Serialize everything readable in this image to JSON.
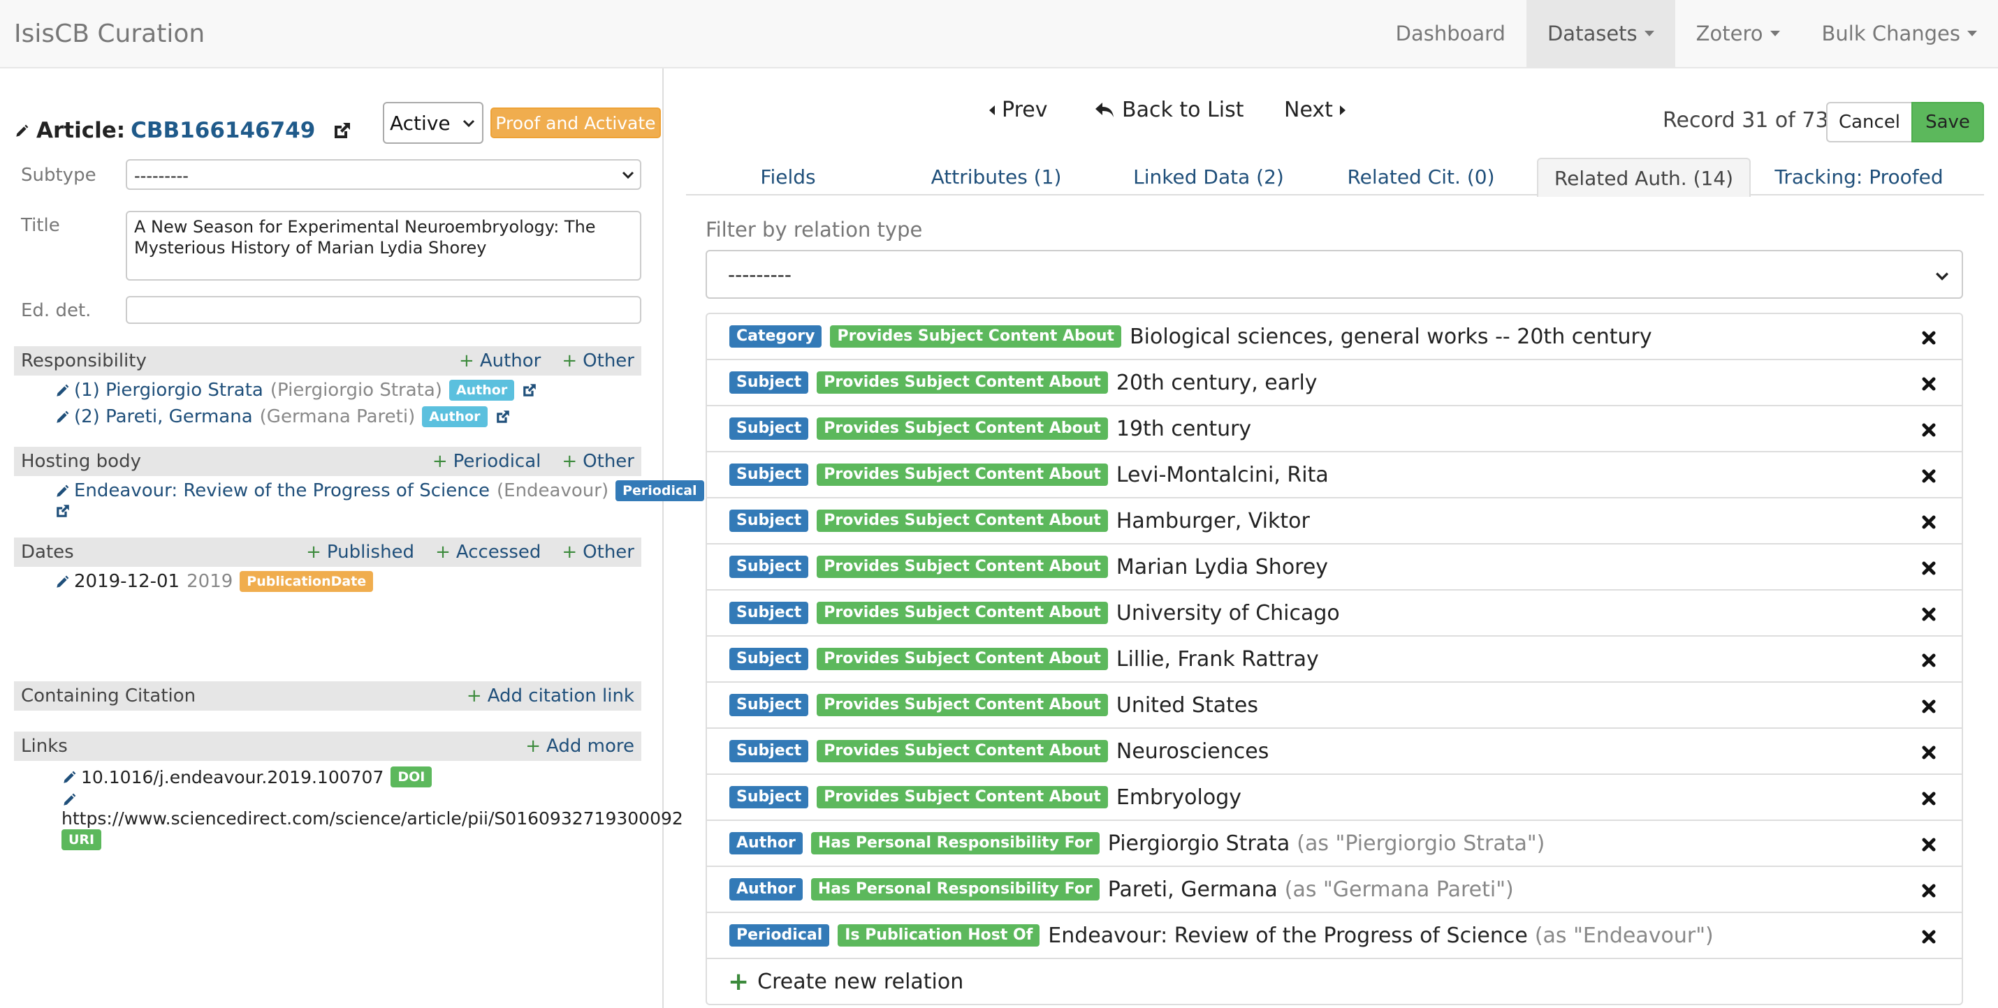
{
  "navbar": {
    "brand": "IsisCB Curation",
    "items": [
      {
        "label": "Dashboard",
        "dropdown": false,
        "active": false
      },
      {
        "label": "Datasets",
        "dropdown": true,
        "active": true
      },
      {
        "label": "Zotero",
        "dropdown": true,
        "active": false
      },
      {
        "label": "Bulk Changes",
        "dropdown": true,
        "active": false
      }
    ]
  },
  "record": {
    "type_label": "Article",
    "id": "CBB166146749",
    "status": "Active",
    "proof_button": "Proof and Activate",
    "subtype_label": "Subtype",
    "subtype_value": "---------",
    "title_label": "Title",
    "title_value": "A New Season for Experimental Neuroembryology: The Mysterious History of Marian Lydia Shorey",
    "eddet_label": "Ed. det.",
    "eddet_value": ""
  },
  "responsibility": {
    "heading": "Responsibility",
    "add_author": "Author",
    "add_other": "Other",
    "entries": [
      {
        "name": "(1) Piergiorgio Strata",
        "as": "(Piergiorgio Strata)",
        "role": "Author"
      },
      {
        "name": "(2) Pareti, Germana",
        "as": "(Germana Pareti)",
        "role": "Author"
      }
    ]
  },
  "hosting": {
    "heading": "Hosting body",
    "add_periodical": "Periodical",
    "add_other": "Other",
    "entry_name": "Endeavour: Review of the Progress of Science",
    "entry_as": "(Endeavour)",
    "entry_role": "Periodical"
  },
  "dates": {
    "heading": "Dates",
    "add_published": "Published",
    "add_accessed": "Accessed",
    "add_other": "Other",
    "entry_date": "2019-12-01",
    "entry_year": "2019",
    "entry_type": "PublicationDate"
  },
  "containing": {
    "heading": "Containing Citation",
    "add_link": "Add citation link"
  },
  "links": {
    "heading": "Links",
    "add_more": "Add more",
    "doi_value": "10.1016/j.endeavour.2019.100707",
    "doi_badge": "DOI",
    "uri_value": "https://www.sciencedirect.com/science/article/pii/S0160932719300092",
    "uri_badge": "URI"
  },
  "pager": {
    "prev": "Prev",
    "back": "Back to List",
    "next": "Next",
    "record_info": "Record 31 of 73",
    "cancel": "Cancel",
    "save": "Save"
  },
  "tabs": [
    {
      "label": "Fields",
      "active": false
    },
    {
      "label": "Attributes (1)",
      "active": false
    },
    {
      "label": "Linked Data (2)",
      "active": false
    },
    {
      "label": "Related Cit. (0)",
      "active": false
    },
    {
      "label": "Related Auth. (14)",
      "active": true
    },
    {
      "label": "Tracking: Proofed",
      "active": false
    }
  ],
  "filter": {
    "label": "Filter by relation type",
    "value": "---------"
  },
  "relations": [
    {
      "type": "Category",
      "relation": "Provides Subject Content About",
      "name": "Biological sciences, general works -- 20th century",
      "as": ""
    },
    {
      "type": "Subject",
      "relation": "Provides Subject Content About",
      "name": "20th century, early",
      "as": ""
    },
    {
      "type": "Subject",
      "relation": "Provides Subject Content About",
      "name": "19th century",
      "as": ""
    },
    {
      "type": "Subject",
      "relation": "Provides Subject Content About",
      "name": "Levi-Montalcini, Rita",
      "as": ""
    },
    {
      "type": "Subject",
      "relation": "Provides Subject Content About",
      "name": "Hamburger, Viktor",
      "as": ""
    },
    {
      "type": "Subject",
      "relation": "Provides Subject Content About",
      "name": "Marian Lydia Shorey",
      "as": ""
    },
    {
      "type": "Subject",
      "relation": "Provides Subject Content About",
      "name": "University of Chicago",
      "as": ""
    },
    {
      "type": "Subject",
      "relation": "Provides Subject Content About",
      "name": "Lillie, Frank Rattray",
      "as": ""
    },
    {
      "type": "Subject",
      "relation": "Provides Subject Content About",
      "name": "United States",
      "as": ""
    },
    {
      "type": "Subject",
      "relation": "Provides Subject Content About",
      "name": "Neurosciences",
      "as": ""
    },
    {
      "type": "Subject",
      "relation": "Provides Subject Content About",
      "name": "Embryology",
      "as": ""
    },
    {
      "type": "Author",
      "relation": "Has Personal Responsibility For",
      "name": "Piergiorgio Strata",
      "as": "(as \"Piergiorgio Strata\")"
    },
    {
      "type": "Author",
      "relation": "Has Personal Responsibility For",
      "name": "Pareti, Germana",
      "as": "(as \"Germana Pareti\")"
    },
    {
      "type": "Periodical",
      "relation": "Is Publication Host Of",
      "name": "Endeavour: Review of the Progress of Science",
      "as": "(as \"Endeavour\")"
    }
  ],
  "create_relation": "Create new relation",
  "colors": {
    "primary": "#337ab7",
    "success": "#5cb85c",
    "warning": "#f0ad4e",
    "info": "#5bc0de",
    "link": "#1f4f7a"
  }
}
